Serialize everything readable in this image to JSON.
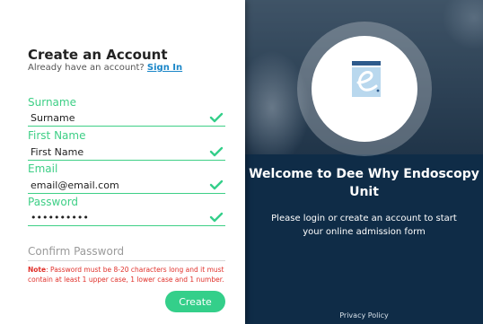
{
  "form": {
    "title": "Create an Account",
    "subtitle_prefix": "Already have an account? ",
    "sign_in_link": "Sign In",
    "fields": [
      {
        "label": "Surname",
        "value": "Surname"
      },
      {
        "label": "First Name",
        "value": "First Name"
      },
      {
        "label": "Email",
        "value": "email@email.com"
      },
      {
        "label": "Password",
        "value": "••••••••••"
      }
    ],
    "confirm_password_label": "Confirm Password",
    "note_label": "Note",
    "note_text": ": Password must be 8-20 characters long and it must contain at least 1 upper case, 1 lower case and 1 number.",
    "create_button": "Create"
  },
  "panel": {
    "welcome_title": "Welcome to Dee Why Endoscopy Unit",
    "description": "Please login or create an account to start your online admission form",
    "privacy_link": "Privacy Policy"
  },
  "colors": {
    "accent_green": "#34cf8a",
    "panel_navy": "#0f2c47",
    "link_blue": "#1a86c8",
    "note_red": "#e0312b"
  },
  "icons": [
    "check-icon",
    "logo-icon"
  ]
}
